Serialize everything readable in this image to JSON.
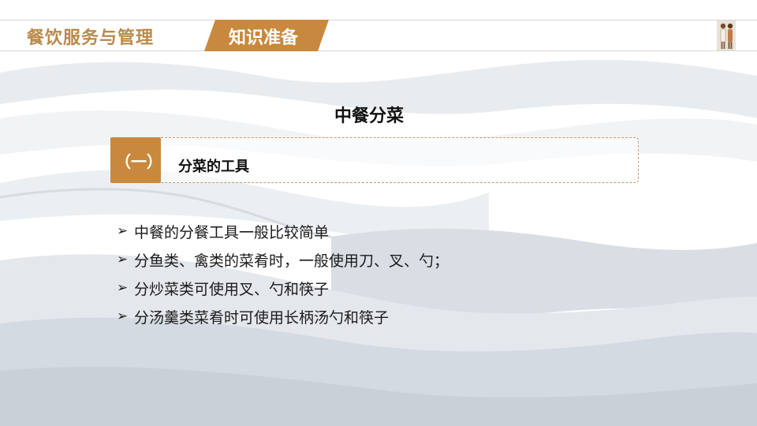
{
  "header": {
    "course_title": "餐饮服务与管理",
    "section_label": "知识准备",
    "accent_color": "#c8893e",
    "title_color": "#b98a4a"
  },
  "slide": {
    "title": "中餐分菜",
    "subheading": {
      "number": "（一）",
      "text": "分菜的工具"
    },
    "bullets": [
      {
        "icon": "chevron-right-icon",
        "marker": "➢",
        "text": "中餐的分餐工具一般比较简单"
      },
      {
        "icon": "chevron-right-icon",
        "marker": "➢",
        "text": "分鱼类、禽类的菜肴时，一般使用刀、叉、勺；"
      },
      {
        "icon": "chevron-right-icon",
        "marker": "➢",
        "text": "分炒菜类可使用叉、勺和筷子"
      },
      {
        "icon": "chevron-right-icon",
        "marker": "➢",
        "text": "分汤羹类菜肴时可使用长柄汤勺和筷子"
      }
    ]
  }
}
